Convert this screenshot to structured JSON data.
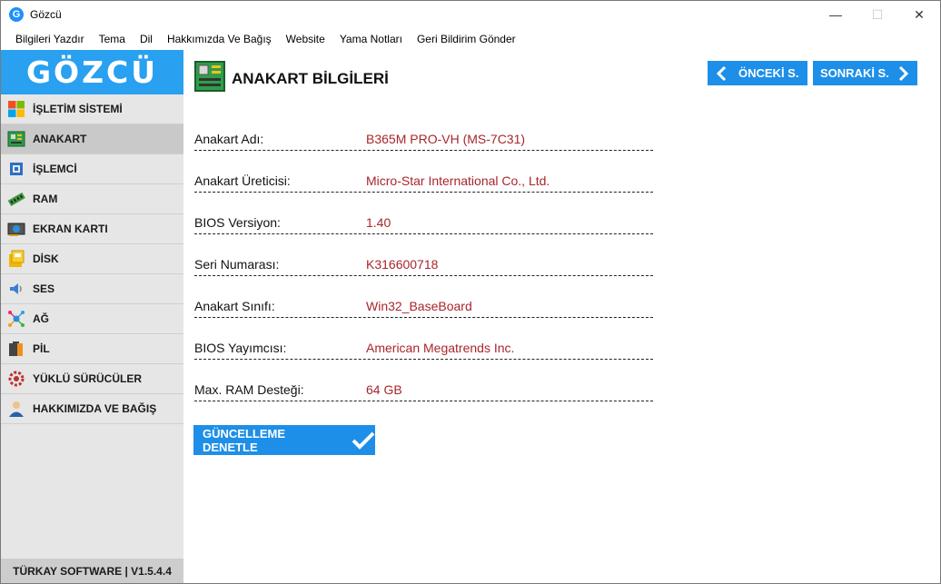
{
  "window": {
    "title": "Gözcü",
    "icon_letter": "G",
    "minimize": "—",
    "maximize": "☐",
    "close": "✕"
  },
  "menu": [
    "Bilgileri Yazdır",
    "Tema",
    "Dil",
    "Hakkımızda Ve Bağış",
    "Website",
    "Yama Notları",
    "Geri Bildirim Gönder"
  ],
  "sidebar": {
    "logo": "GÖZCÜ",
    "items": [
      {
        "label": "İŞLETİM SİSTEMİ",
        "icon": "windows-icon"
      },
      {
        "label": "ANAKART",
        "icon": "motherboard-icon"
      },
      {
        "label": "İŞLEMCİ",
        "icon": "cpu-icon"
      },
      {
        "label": "RAM",
        "icon": "ram-icon"
      },
      {
        "label": "EKRAN KARTI",
        "icon": "gpu-icon"
      },
      {
        "label": "DİSK",
        "icon": "disk-icon"
      },
      {
        "label": "SES",
        "icon": "speaker-icon"
      },
      {
        "label": "AĞ",
        "icon": "network-icon"
      },
      {
        "label": "PİL",
        "icon": "battery-icon"
      },
      {
        "label": "YÜKLÜ SÜRÜCÜLER",
        "icon": "drivers-icon"
      },
      {
        "label": "HAKKIMIZDA VE BAĞIŞ",
        "icon": "person-icon"
      }
    ],
    "active_index": 1,
    "footer": "TÜRKAY SOFTWARE  |  V1.5.4.4"
  },
  "main": {
    "title": "ANAKART BİLGİLERİ",
    "prev_label": "ÖNCEKİ S.",
    "next_label": "SONRAKİ S.",
    "rows": [
      {
        "label": "Anakart Adı:",
        "value": "B365M PRO-VH (MS-7C31)"
      },
      {
        "label": "Anakart Üreticisi:",
        "value": "Micro-Star International Co., Ltd."
      },
      {
        "label": "BIOS Versiyon:",
        "value": "1.40"
      },
      {
        "label": "Seri Numarası:",
        "value": "K316600718"
      },
      {
        "label": "Anakart Sınıfı:",
        "value": "Win32_BaseBoard"
      },
      {
        "label": "BIOS Yayımcısı:",
        "value": "American Megatrends Inc."
      },
      {
        "label": "Max. RAM Desteği:",
        "value": "64 GB"
      }
    ],
    "separator": "-----------------------------------------------------------------------------------------------------",
    "update_label": "GÜNCELLEME DENETLE"
  },
  "colors": {
    "accent": "#1e8fe8",
    "value_text": "#a8262b",
    "sidebar_bg": "#e6e6e6",
    "logo_bg": "#29a0f0"
  }
}
